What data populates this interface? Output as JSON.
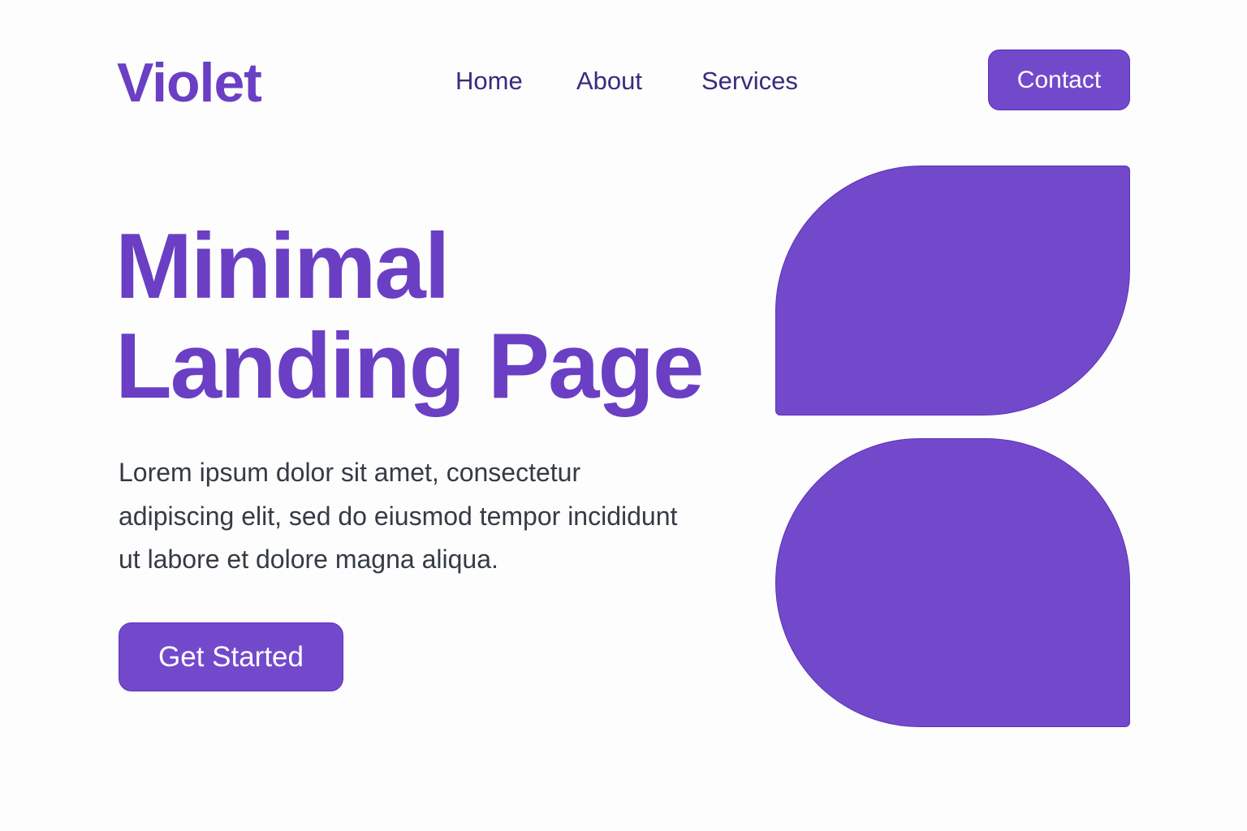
{
  "brand": {
    "name": "Violet",
    "accent_color": "#7349cc"
  },
  "nav": {
    "items": [
      {
        "label": "Home"
      },
      {
        "label": "About"
      },
      {
        "label": "Services"
      }
    ],
    "contact_label": "Contact"
  },
  "hero": {
    "title_line1": "Minimal",
    "title_line2": "Landing Page",
    "body": "Lorem ipsum dolor sit amet, consectetur adipiscing elit, sed do eiusmod tempor incididunt ut labore et dolore magna aliqua.",
    "cta_label": "Get Started"
  }
}
